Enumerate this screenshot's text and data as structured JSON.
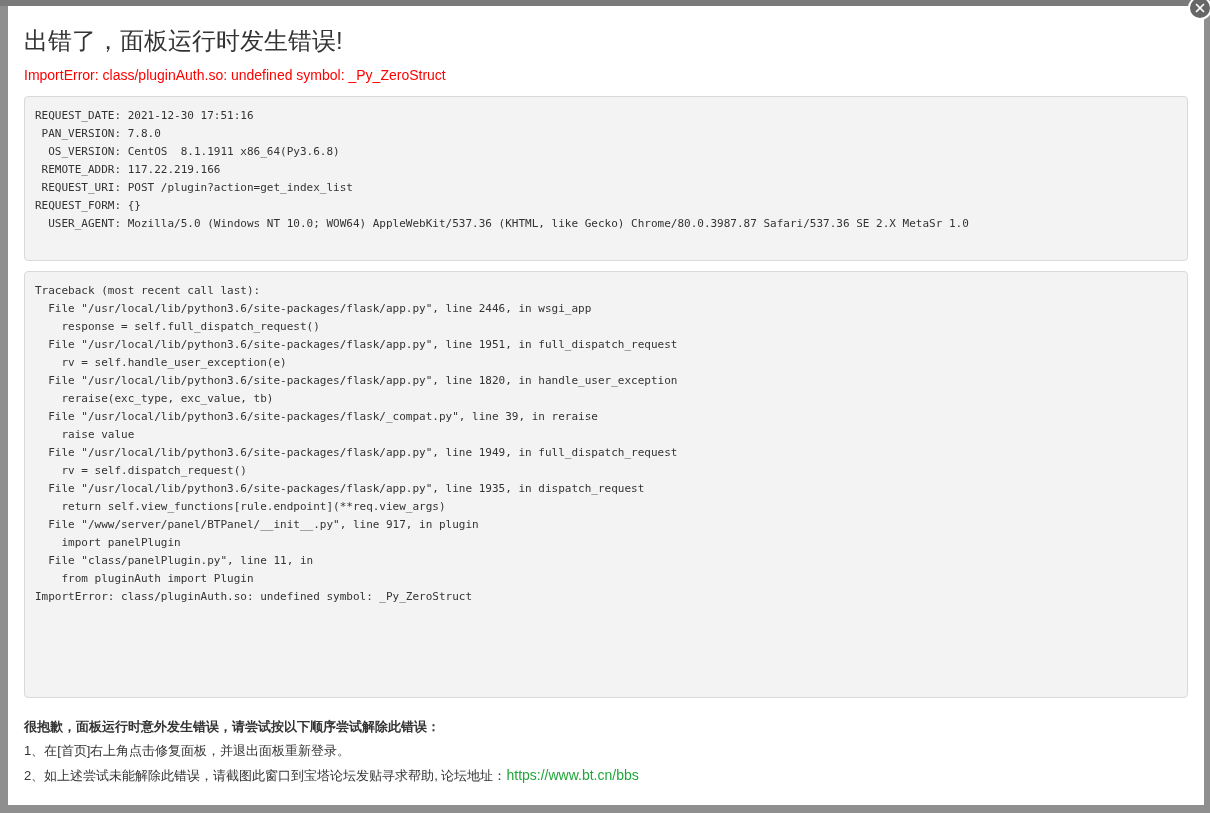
{
  "dialog": {
    "title": "出错了，面板运行时发生错误!",
    "error": "ImportError: class/pluginAuth.so: undefined symbol: _Py_ZeroStruct",
    "request_info": [
      "REQUEST_DATE: 2021-12-30 17:51:16",
      " PAN_VERSION: 7.8.0",
      "  OS_VERSION: CentOS  8.1.1911 x86_64(Py3.6.8)",
      " REMOTE_ADDR: 117.22.219.166",
      " REQUEST_URI: POST /plugin?action=get_index_list",
      "REQUEST_FORM: {}",
      "  USER_AGENT: Mozilla/5.0 (Windows NT 10.0; WOW64) AppleWebKit/537.36 (KHTML, like Gecko) Chrome/80.0.3987.87 Safari/537.36 SE 2.X MetaSr 1.0"
    ],
    "traceback": [
      "Traceback (most recent call last):",
      "  File \"/usr/local/lib/python3.6/site-packages/flask/app.py\", line 2446, in wsgi_app",
      "    response = self.full_dispatch_request()",
      "  File \"/usr/local/lib/python3.6/site-packages/flask/app.py\", line 1951, in full_dispatch_request",
      "    rv = self.handle_user_exception(e)",
      "  File \"/usr/local/lib/python3.6/site-packages/flask/app.py\", line 1820, in handle_user_exception",
      "    reraise(exc_type, exc_value, tb)",
      "  File \"/usr/local/lib/python3.6/site-packages/flask/_compat.py\", line 39, in reraise",
      "    raise value",
      "  File \"/usr/local/lib/python3.6/site-packages/flask/app.py\", line 1949, in full_dispatch_request",
      "    rv = self.dispatch_request()",
      "  File \"/usr/local/lib/python3.6/site-packages/flask/app.py\", line 1935, in dispatch_request",
      "    return self.view_functions[rule.endpoint](**req.view_args)",
      "  File \"/www/server/panel/BTPanel/__init__.py\", line 917, in plugin",
      "    import panelPlugin",
      "  File \"class/panelPlugin.py\", line 11, in",
      "    from pluginAuth import Plugin",
      "ImportError: class/pluginAuth.so: undefined symbol: _Py_ZeroStruct"
    ],
    "help_heading": "很抱歉，面板运行时意外发生错误，请尝试按以下顺序尝试解除此错误：",
    "help_steps": [
      {
        "text": "1、在[首页]右上角点击修复面板，并退出面板重新登录。"
      },
      {
        "text": "2、如上述尝试未能解除此错误，请截图此窗口到宝塔论坛发贴寻求帮助, 论坛地址：",
        "link": "https://www.bt.cn/bbs"
      }
    ]
  }
}
